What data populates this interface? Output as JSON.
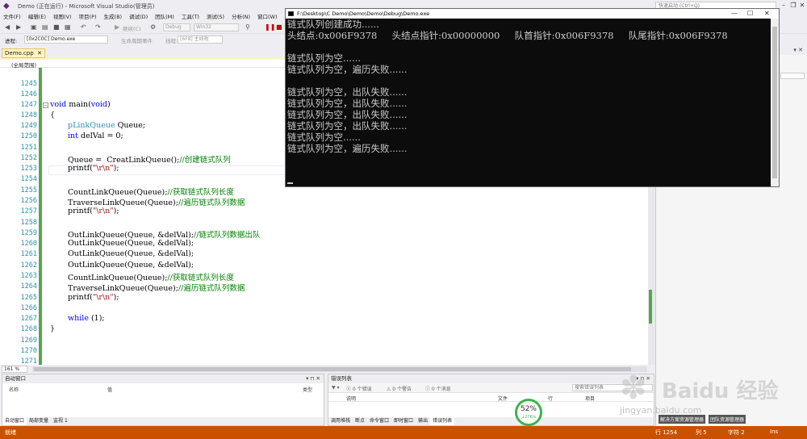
{
  "window": {
    "title": "Demo (正在运行) - Microsoft Visual Studio(管理员)",
    "quick_launch": "快速启动 (Ctrl+Q)"
  },
  "menu": [
    "文件(F)",
    "编辑(E)",
    "视图(V)",
    "项目(P)",
    "生成(B)",
    "调试(D)",
    "团队(M)",
    "工具(T)",
    "测试(S)",
    "分析(N)",
    "窗口(W)"
  ],
  "toolbar": {
    "continue_label": "继续(C)",
    "config": "Debug",
    "platform": "Win32",
    "process_label": "进程:",
    "process_value": "[0x2C0C] Demo.exe",
    "lifecycle_label": "生命周期事件",
    "thread_label": "线程:",
    "thread_value": "[6F8] 主线程"
  },
  "editor": {
    "tab_name": "Demo.cpp",
    "scope": "(全局范围)",
    "zoom": "161 %",
    "lines": [
      {
        "n": "1245",
        "t": ""
      },
      {
        "n": "1246",
        "t": ""
      },
      {
        "n": "1247",
        "t": "void main(void)"
      },
      {
        "n": "1248",
        "t": "{"
      },
      {
        "n": "1249",
        "t": "pLinkQueue Queue;"
      },
      {
        "n": "1250",
        "t": "int delVal = 0;"
      },
      {
        "n": "1251",
        "t": ""
      },
      {
        "n": "1252",
        "t": "Queue = CreatLinkQueue();//创建链式队列"
      },
      {
        "n": "1253",
        "t": "printf(\"\\r\\n\");"
      },
      {
        "n": "1254",
        "t": ""
      },
      {
        "n": "1255",
        "t": "CountLinkQueue(Queue);//获取链式队列长度"
      },
      {
        "n": "1256",
        "t": "TraverseLinkQueue(Queue);//遍历链式队列数据"
      },
      {
        "n": "1257",
        "t": "printf(\"\\r\\n\");"
      },
      {
        "n": "1258",
        "t": ""
      },
      {
        "n": "1259",
        "t": "OutLinkQueue(Queue, &delVal);//链式队列数据出队"
      },
      {
        "n": "1260",
        "t": "OutLinkQueue(Queue, &delVal);"
      },
      {
        "n": "1261",
        "t": "OutLinkQueue(Queue, &delVal);"
      },
      {
        "n": "1262",
        "t": "OutLinkQueue(Queue, &delVal);"
      },
      {
        "n": "1263",
        "t": "CountLinkQueue(Queue);//获取链式队列长度"
      },
      {
        "n": "1264",
        "t": "TraverseLinkQueue(Queue);//遍历链式队列数据"
      },
      {
        "n": "1265",
        "t": "printf(\"\\r\\n\");"
      },
      {
        "n": "1266",
        "t": ""
      },
      {
        "n": "1267",
        "t": "while (1);"
      },
      {
        "n": "1268",
        "t": "}"
      },
      {
        "n": "1269",
        "t": ""
      },
      {
        "n": "1270",
        "t": ""
      },
      {
        "n": "1271",
        "t": ""
      }
    ]
  },
  "console": {
    "title": "F:\\Desktop\\C Demo\\Demo\\Demo\\Debug\\Demo.exe",
    "lines": [
      "链式队列创建成功......",
      "头结点:0x006F9378     头结点指针:0x00000000     队首指针:0x006F9378     队尾指针:0x006F9378",
      "",
      "链式队列为空......",
      "链式队列为空，遍历失败......",
      "",
      "链式队列为空，出队失败......",
      "链式队列为空，出队失败......",
      "链式队列为空，出队失败......",
      "链式队列为空，出队失败......",
      "链式队列为空......",
      "链式队列为空，遍历失败......"
    ]
  },
  "autos": {
    "title": "自动窗口",
    "col_name": "名称",
    "col_value": "值",
    "col_type": "类型",
    "tabs": [
      "自动窗口",
      "局部变量",
      "监视 1"
    ]
  },
  "errors": {
    "title": "错误列表",
    "errors": "0 个错误",
    "warnings": "0 个警告",
    "messages": "0 个消息",
    "search": "搜索错误列表",
    "col_desc": "说明",
    "col_file": "文件",
    "col_line": "行",
    "col_project": "项目",
    "tabs": [
      "调用堆栈",
      "断点",
      "命令窗口",
      "即时窗口",
      "输出",
      "错误列表"
    ]
  },
  "side_tabs": [
    "解决方案资源管理器",
    "团队资源管理器"
  ],
  "perf": {
    "pct": "52%",
    "speed": "↓27K/s"
  },
  "watermark": {
    "main": "Baidu 经验",
    "sub": "jingyan.baidu.com"
  },
  "status": {
    "ready": "就绪",
    "line": "行 1254",
    "col": "列 5",
    "char": "字符 2",
    "mode": "Ins"
  },
  "colors": {
    "accent": "#ca5100",
    "console_bg": "#0c0c0c",
    "keyword": "#0000ff",
    "type": "#2b91af",
    "comment": "#008000",
    "string": "#a31515"
  }
}
